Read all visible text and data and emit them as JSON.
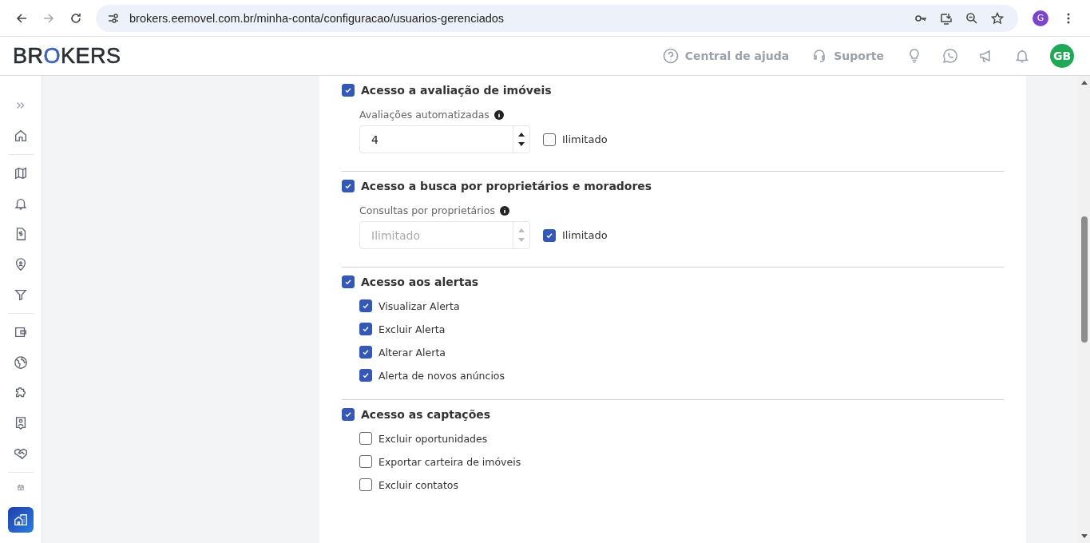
{
  "browser": {
    "url": "brokers.eemovel.com.br/minha-conta/configuracao/usuarios-gerenciados",
    "profile": "G"
  },
  "header": {
    "logo": "BROKERS",
    "help": "Central de ajuda",
    "support": "Suporte",
    "avatar": "GB"
  },
  "sections": [
    {
      "kind": "number",
      "title": "Acesso a avaliação de imóveis",
      "checked": true,
      "field_label": "Avaliações automatizadas",
      "field": {
        "value": "4",
        "disabled": false
      },
      "unlimited": {
        "label": "Ilimitado",
        "checked": false
      }
    },
    {
      "kind": "number",
      "title": "Acesso a busca por proprietários e moradores",
      "checked": true,
      "field_label": "Consultas por proprietários",
      "field": {
        "placeholder": "Ilimitado",
        "disabled": true
      },
      "unlimited": {
        "label": "Ilimitado",
        "checked": true
      }
    },
    {
      "kind": "list",
      "title": "Acesso aos alertas",
      "checked": true,
      "items": [
        {
          "label": "Visualizar Alerta",
          "checked": true
        },
        {
          "label": "Excluir Alerta",
          "checked": true
        },
        {
          "label": "Alterar Alerta",
          "checked": true
        },
        {
          "label": "Alerta de novos anúncios",
          "checked": true
        }
      ]
    },
    {
      "kind": "list",
      "title": "Acesso as captações",
      "checked": true,
      "items": [
        {
          "label": "Excluir oportunidades",
          "checked": false
        },
        {
          "label": "Exportar carteira de imóveis",
          "checked": false
        },
        {
          "label": "Excluir contatos",
          "checked": false
        }
      ]
    }
  ]
}
